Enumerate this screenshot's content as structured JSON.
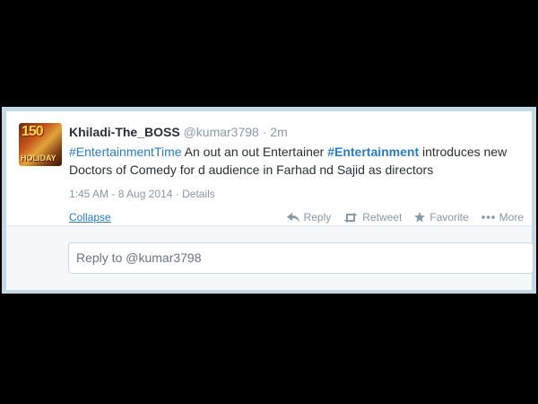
{
  "tweet": {
    "avatar_lettering": "150 HOLIDAY",
    "user_name": "Khiladi-The_BOSS",
    "handle": "@kumar3798",
    "separator": "·",
    "time_ago": "2m",
    "text_parts": {
      "hashtag1": "#EntertainmentTime",
      "segment1": " An out an out Entertainer ",
      "hashtag2": "#Entertainment",
      "segment2": " introduces new Doctors of Comedy for d audience in Farhad nd Sajid as directors"
    },
    "timestamp": "1:45 AM - 8 Aug 2014",
    "meta_separator": "·",
    "details_label": "Details",
    "collapse_label": "Collapse",
    "actions": {
      "reply": "Reply",
      "retweet": "Retweet",
      "favorite": "Favorite",
      "more": "More"
    }
  },
  "reply": {
    "prefill": "Reply to @kumar3798"
  },
  "colors": {
    "link": "#2b7bb9",
    "muted": "#8899a6",
    "border": "#c5d8e6"
  }
}
